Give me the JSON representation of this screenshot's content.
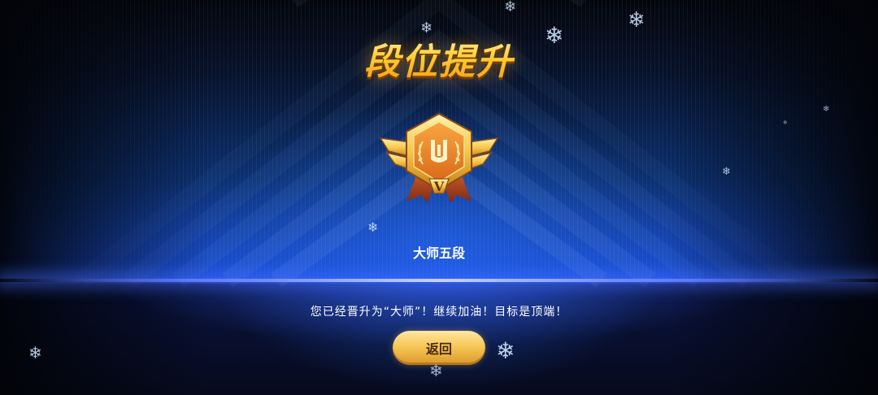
{
  "title": "段位提升",
  "rank": {
    "name": "大师五段",
    "tier_numeral": "V"
  },
  "message": "您已经晋升为“大师”！继续加油！目标是顶端！",
  "back_button_label": "返回",
  "icons": {
    "badge": "master-rank-badge-icon",
    "snowflake": "snowflake-icon"
  },
  "colors": {
    "title_gold": "#ffd13a",
    "button_gold": "#f5c451",
    "floor_blue": "#2c52ff"
  }
}
